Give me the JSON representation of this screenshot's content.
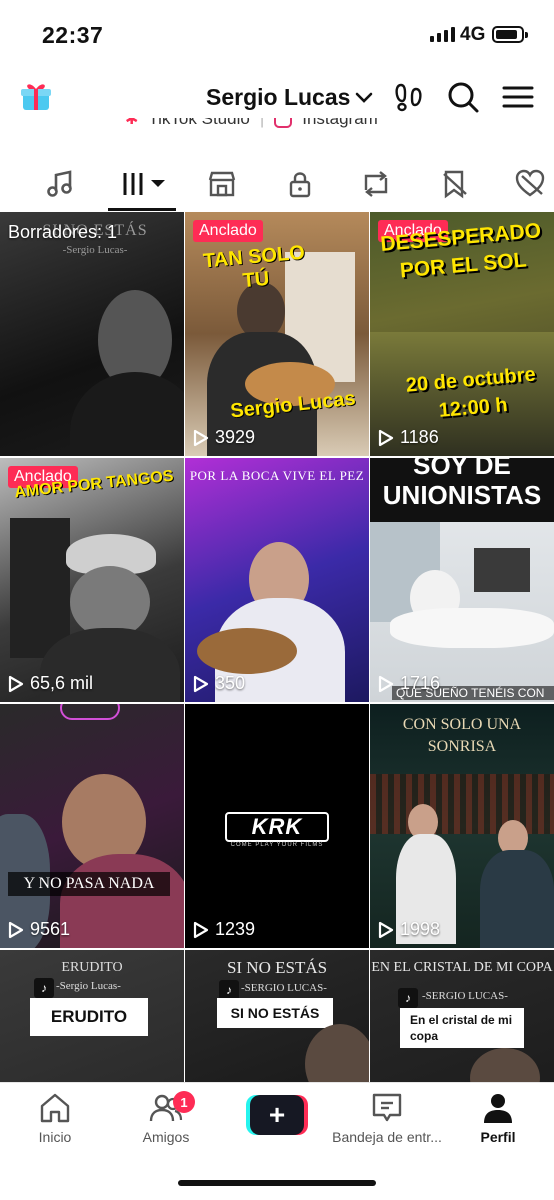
{
  "status": {
    "time": "22:37",
    "network": "4G"
  },
  "header": {
    "profile_name": "Sergio Lucas"
  },
  "links": {
    "studio": "TikTok Studio",
    "instagram": "Instagram"
  },
  "tabs": [
    "music",
    "videos",
    "shop",
    "private",
    "reposts",
    "favorites",
    "liked"
  ],
  "grid": {
    "drafts_label": "Borradores: 1",
    "pinned_label": "Anclado",
    "tiles": [
      {
        "caption_top": "SI NO ESTÁS",
        "caption_sub": "-Sergio Lucas-",
        "views": ""
      },
      {
        "caption_top": "TAN SOLO TÚ",
        "caption_bottom": "Sergio Lucas",
        "views": "3929"
      },
      {
        "caption_top": "DESESPERADO POR EL SOL",
        "caption_bottom": "20 de octubre 12:00 h",
        "views": "1186"
      },
      {
        "caption_top": "AMOR POR TANGOS",
        "views": "65,6 mil"
      },
      {
        "caption_top": "POR LA BOCA VIVE EL PEZ",
        "views": "350"
      },
      {
        "caption_top": "SOY DE UNIONISTAS",
        "caption_bottom": "QUE SUEÑO TENÉIS CON",
        "views": "1716"
      },
      {
        "caption_mid": "Y NO PASA NADA",
        "views": "9561"
      },
      {
        "logo": "KRK",
        "logo_sub": "COME PLAY YOUR FILMS",
        "views": "1239"
      },
      {
        "caption_top": "CON SOLO UNA SONRISA",
        "views": "1998"
      },
      {
        "caption_top": "ERUDITO",
        "caption_sub": "-Sergio Lucas-",
        "label": "ERUDITO"
      },
      {
        "caption_top": "SI NO ESTÁS",
        "caption_sub": "-SERGIO LUCAS-",
        "label": "SI NO ESTÁS"
      },
      {
        "caption_top": "EN EL CRISTAL DE MI COPA",
        "caption_sub": "-SERGIO LUCAS-",
        "label": "En el cristal de mi copa"
      }
    ]
  },
  "nav": {
    "home": "Inicio",
    "friends": "Amigos",
    "friends_badge": "1",
    "create": "+",
    "inbox": "Bandeja de entr...",
    "profile": "Perfil"
  },
  "colors": {
    "accent": "#fe2c55",
    "cyan": "#25f4ee",
    "dark": "#161823"
  }
}
